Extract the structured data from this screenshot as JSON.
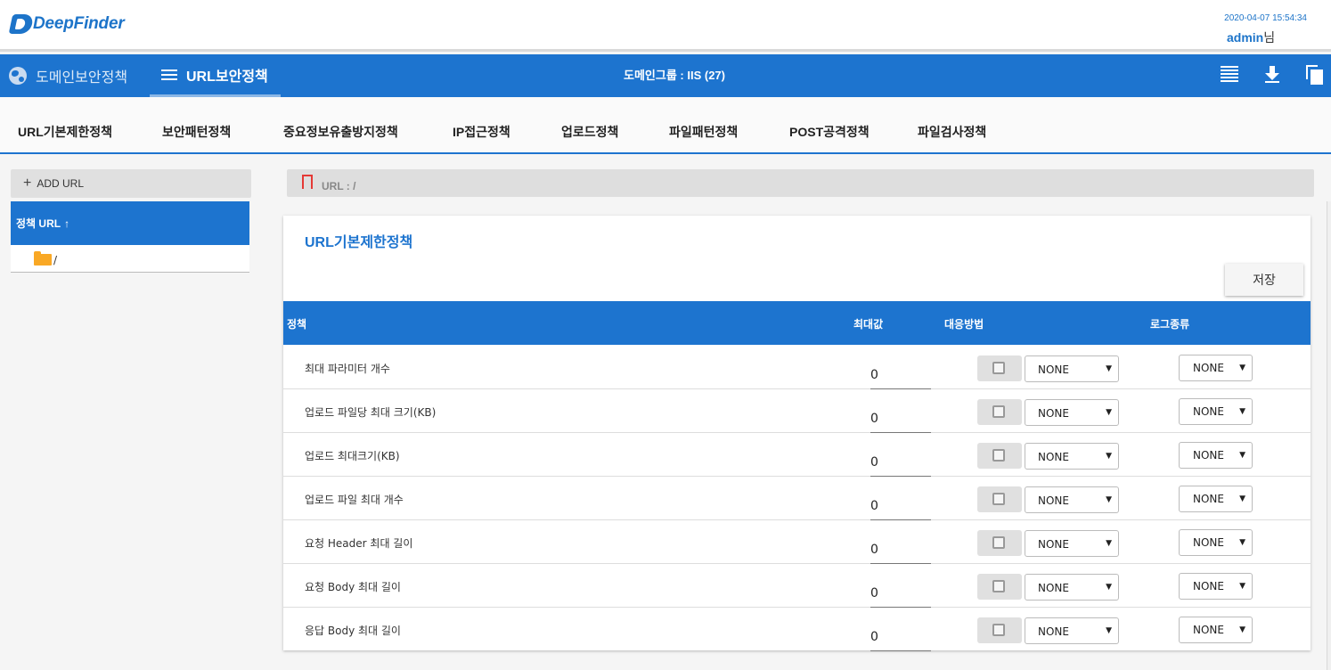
{
  "header": {
    "logo_text": "DeepFinder",
    "datetime": "2020-04-07 15:54:34",
    "user_name": "admin",
    "user_suffix": "님"
  },
  "nav": {
    "domain_policy": "도메인보안정책",
    "url_policy": "URL보안정책",
    "domain_group": "도메인그룹 : IIS (27)",
    "icons": [
      "list-icon",
      "download-icon",
      "copy-icon"
    ]
  },
  "subtabs": [
    "URL기본제한정책",
    "보안패턴정책",
    "중요정보유출방지정책",
    "IP접근정책",
    "업로드정책",
    "파일패턴정책",
    "POST공격정책",
    "파일검사정책"
  ],
  "left_panel": {
    "add_url": "ADD URL",
    "tree_header": "정책 URL",
    "sort_arrow": "↑",
    "root_label": "/"
  },
  "breadcrumb": {
    "text": "URL : /"
  },
  "card": {
    "title": "URL기본제한정책",
    "save_label": "저장",
    "columns": {
      "policy": "정책",
      "max_value": "최대값",
      "action": "대응방법",
      "log_type": "로그종류"
    },
    "rows": [
      {
        "label": "최대 파라미터 개수",
        "max": "0",
        "action": "NONE",
        "log": "NONE"
      },
      {
        "label": "업로드 파일당 최대 크기(KB)",
        "max": "0",
        "action": "NONE",
        "log": "NONE"
      },
      {
        "label": "업로드 최대크기(KB)",
        "max": "0",
        "action": "NONE",
        "log": "NONE"
      },
      {
        "label": "업로드 파일 최대 개수",
        "max": "0",
        "action": "NONE",
        "log": "NONE"
      },
      {
        "label": "요청 Header 최대 길이",
        "max": "0",
        "action": "NONE",
        "log": "NONE"
      },
      {
        "label": "요청 Body 최대 길이",
        "max": "0",
        "action": "NONE",
        "log": "NONE"
      },
      {
        "label": "응답 Body 최대 길이",
        "max": "0",
        "action": "NONE",
        "log": "NONE"
      }
    ]
  },
  "colors": {
    "accent": "#1d74cf",
    "folder": "#f9a825",
    "bookmark": "#e53935"
  }
}
